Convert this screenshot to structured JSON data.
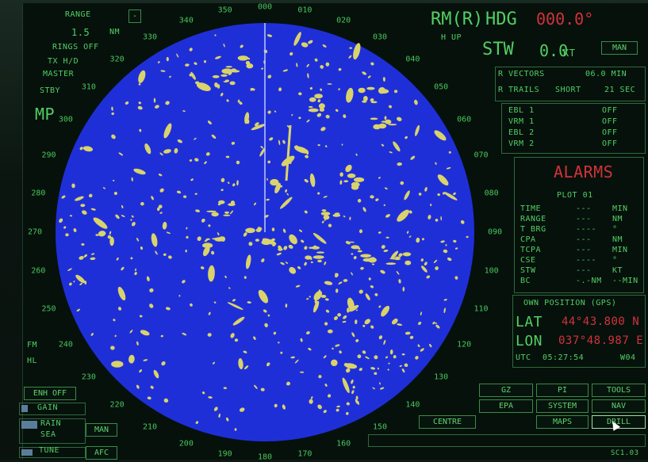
{
  "range": {
    "label": "RANGE",
    "value": "1.5",
    "unit": "NM",
    "rings": "RINGS OFF"
  },
  "modes": {
    "tx": "TX H/D",
    "master": "MASTER",
    "stby": "STBY",
    "mp": "MP"
  },
  "side_labels": {
    "fm": "FM",
    "hl": "HL"
  },
  "left_controls": {
    "enh": "ENH OFF",
    "gain": "GAIN",
    "rain": "RAIN",
    "sea": "SEA",
    "man": "MAN",
    "tune": "TUNE",
    "afc": "AFC"
  },
  "header": {
    "rm": "RM(R)",
    "hup": "H UP",
    "hdg_label": "HDG",
    "hdg_value": "000.0°",
    "stw_label": "STW",
    "stw_value": "0.0",
    "stw_unit": "KT",
    "man": "MAN"
  },
  "vectors": {
    "r_vectors": "R VECTORS",
    "r_vectors_val": "06.0 MIN",
    "r_trails": "R TRAILS",
    "r_trails_mode": "SHORT",
    "r_trails_val": "21 SEC"
  },
  "ebl_vrm": [
    {
      "label": "EBL 1",
      "value": "OFF"
    },
    {
      "label": "VRM 1",
      "value": "OFF"
    },
    {
      "label": "EBL 2",
      "value": "OFF"
    },
    {
      "label": "VRM 2",
      "value": "OFF"
    }
  ],
  "alarms": {
    "title": "ALARMS",
    "plot": "PLOT 01"
  },
  "plot_rows": [
    {
      "label": "TIME",
      "value": "---",
      "unit": "MIN"
    },
    {
      "label": "RANGE",
      "value": "---",
      "unit": "NM"
    },
    {
      "label": "T BRG",
      "value": "----",
      "unit": "°"
    },
    {
      "label": "CPA",
      "value": "---",
      "unit": "NM"
    },
    {
      "label": "TCPA",
      "value": "---",
      "unit": "MIN"
    },
    {
      "label": "CSE",
      "value": "----",
      "unit": "°"
    },
    {
      "label": "STW",
      "value": "---",
      "unit": "KT"
    },
    {
      "label": "BC",
      "value": "-.-NM",
      "unit": "--MIN"
    }
  ],
  "own_position": {
    "title": "OWN POSITION (GPS)",
    "lat_label": "LAT",
    "lat_value": "44°43.800 N",
    "lon_label": "LON",
    "lon_value": "037°48.987 E",
    "utc_label": "UTC",
    "utc_value": "05:27:54",
    "wpt": "W04"
  },
  "buttons": {
    "gz": "GZ",
    "pi": "PI",
    "tools": "TOOLS",
    "epa": "EPA",
    "system": "SYSTEM",
    "nav": "NAV",
    "centre": "CENTRE",
    "maps": "MAPS",
    "drill": "DRILL"
  },
  "footer": {
    "code": "SC1.03"
  },
  "bearings": [
    "000",
    "010",
    "020",
    "030",
    "040",
    "050",
    "060",
    "070",
    "080",
    "090",
    "100",
    "110",
    "120",
    "130",
    "140",
    "150",
    "160",
    "170",
    "180",
    "190",
    "200",
    "210",
    "220",
    "230",
    "240",
    "250",
    "260",
    "270",
    "280",
    "290",
    "300",
    "310",
    "320",
    "330",
    "340",
    "350"
  ],
  "colors": {
    "ppi": "#1f2fd8",
    "echo": "#d9d36a",
    "text": "#52cf62",
    "alarm": "#d3323a"
  }
}
